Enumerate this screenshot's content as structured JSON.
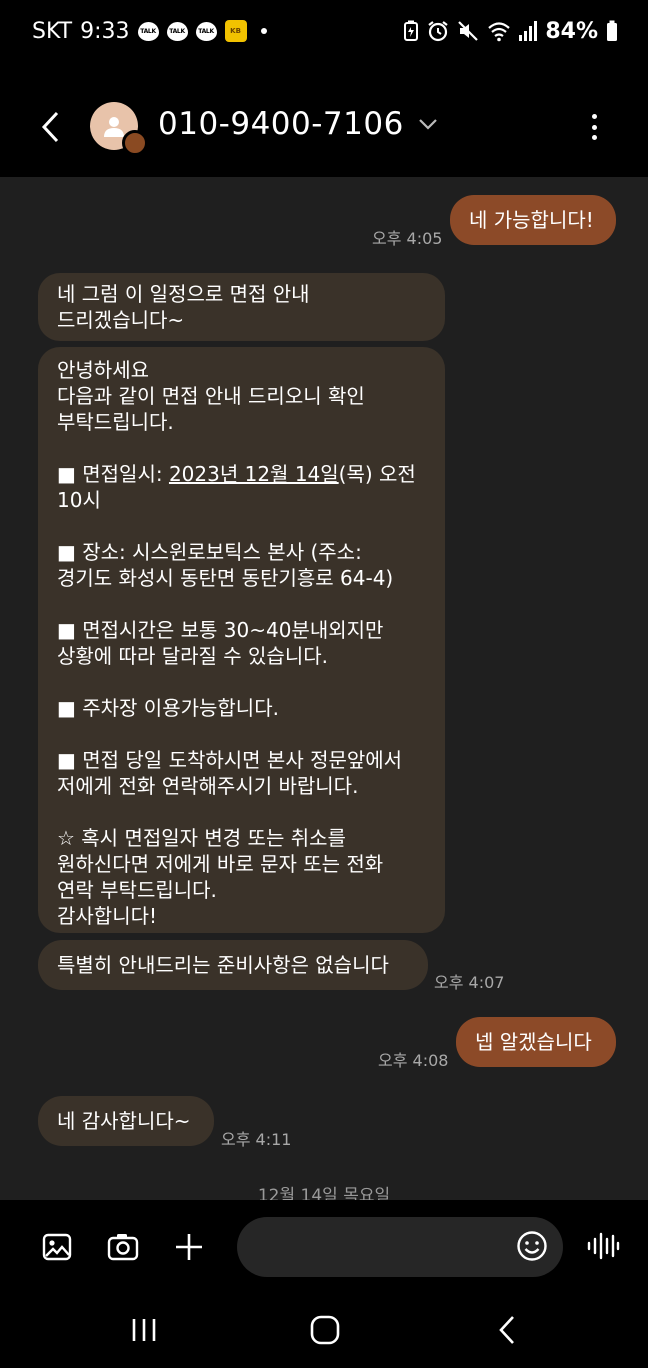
{
  "status_bar": {
    "carrier": "SKT",
    "time": "9:33",
    "talk_label": "TALK",
    "battery": "84%"
  },
  "header": {
    "contact": "010-9400-7106"
  },
  "messages": {
    "m1": {
      "text": "네 가능합니다!",
      "time": "오후 4:05"
    },
    "m2": {
      "text": "네 그럼 이 일정으로 면접 안내\n드리겠습니다~"
    },
    "m3": {
      "part1": "안녕하세요\n다음과 같이 면접 안내 드리오니 확인\n부탁드립니다.\n\n■ 면접일시: ",
      "date_link": "2023년 12월 14일",
      "part2": "(목) 오전\n10시\n\n■ 장소: 시스윈로보틱스 본사 (주소:\n경기도 화성시 동탄면 동탄기흥로 64-4)\n\n■ 면접시간은 보통 30~40분내외지만\n상황에 따라 달라질 수 있습니다.\n\n■ 주차장 이용가능합니다.\n\n■ 면접 당일 도착하시면 본사 정문앞에서\n저에게 전화 연락해주시기 바랍니다.\n\n☆ 혹시 면접일자 변경 또는 취소를\n원하신다면 저에게 바로 문자 또는 전화\n연락 부탁드립니다.\n감사합니다!"
    },
    "m4": {
      "text": "특별히 안내드리는 준비사항은 없습니다",
      "time": "오후 4:07"
    },
    "m5": {
      "text": "넵 알겠습니다",
      "time": "오후 4:08"
    },
    "m6": {
      "text": "네 감사합니다~",
      "time": "오후 4:11"
    }
  },
  "date_divider": "12월 14일 목요일",
  "input": {
    "placeholder": "",
    "value": ""
  },
  "colors": {
    "outgoing_bubble": "#8c4a28",
    "incoming_bubble": "#3a3229",
    "conversation_bg": "#1f1f1f"
  },
  "icons": [
    "back-arrow-icon",
    "person-icon",
    "chevron-down-icon",
    "more-vertical-icon",
    "gallery-icon",
    "camera-icon",
    "plus-icon",
    "emoji-icon",
    "voice-wave-icon",
    "recent-apps-icon",
    "home-icon",
    "nav-back-icon"
  ]
}
